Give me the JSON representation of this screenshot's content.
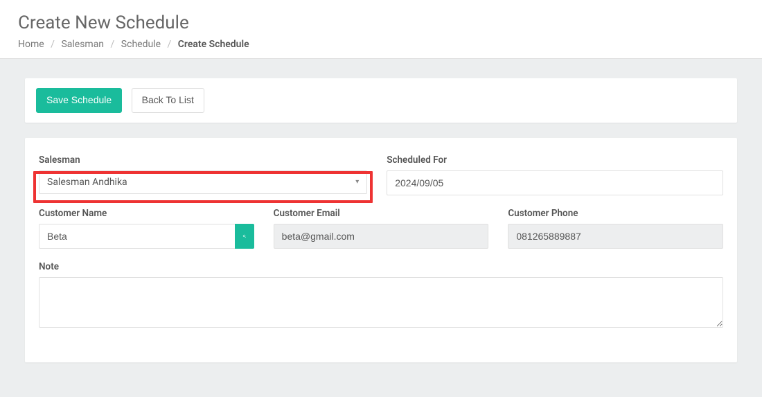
{
  "header": {
    "title": "Create New Schedule",
    "breadcrumb": {
      "home": "Home",
      "salesman": "Salesman",
      "schedule": "Schedule",
      "current": "Create Schedule"
    }
  },
  "toolbar": {
    "save_label": "Save Schedule",
    "back_label": "Back To List"
  },
  "form": {
    "salesman": {
      "label": "Salesman",
      "value": "Salesman Andhika"
    },
    "scheduled_for": {
      "label": "Scheduled For",
      "value": "2024/09/05"
    },
    "customer_name": {
      "label": "Customer Name",
      "value": "Beta"
    },
    "customer_email": {
      "label": "Customer Email",
      "value": "beta@gmail.com"
    },
    "customer_phone": {
      "label": "Customer Phone",
      "value": "081265889887"
    },
    "note": {
      "label": "Note",
      "value": ""
    }
  }
}
